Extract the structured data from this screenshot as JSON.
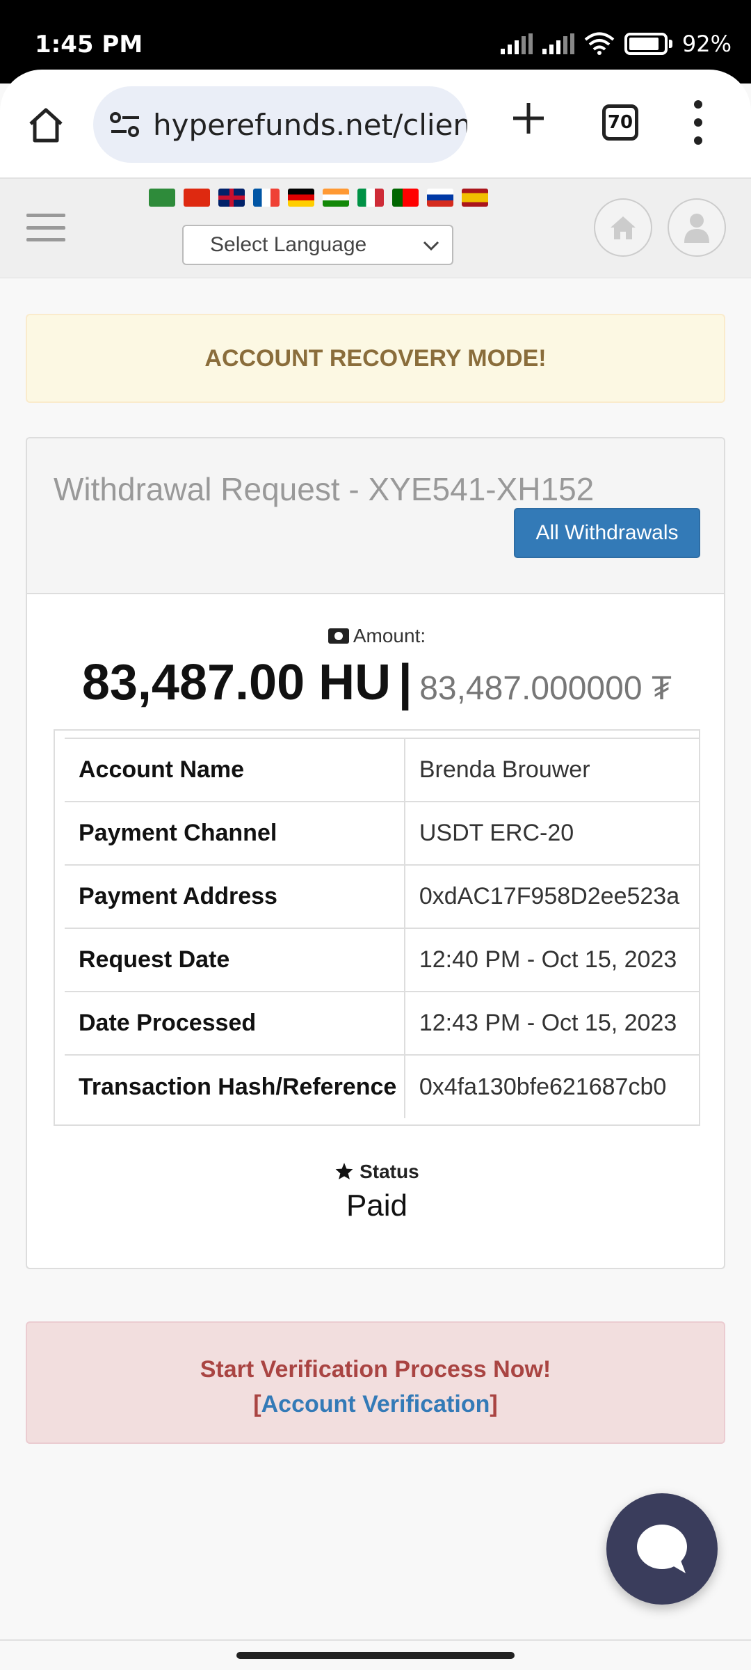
{
  "status_bar": {
    "time": "1:45 PM",
    "battery": "92%"
  },
  "browser": {
    "url": "hyperefunds.net/client",
    "tab_count": "70"
  },
  "header": {
    "language_placeholder": "Select Language",
    "flags": [
      "arabic",
      "chinese",
      "english",
      "french",
      "german",
      "hindi",
      "italian",
      "portuguese",
      "russian",
      "spanish"
    ]
  },
  "alert_warning": {
    "text": "ACCOUNT RECOVERY MODE!"
  },
  "panel": {
    "title": "Withdrawal Request - XYE541-XH152",
    "all_withdrawals_label": "All Withdrawals",
    "amount_label": "Amount:",
    "amount_main": "83,487.00 HU",
    "amount_separator": "|",
    "amount_secondary": "83,487.000000 ₮",
    "details": [
      {
        "key": "Account Name",
        "value": "Brenda Brouwer"
      },
      {
        "key": "Payment Channel",
        "value": "USDT ERC-20"
      },
      {
        "key": "Payment Address",
        "value": "0xdAC17F958D2ee523a"
      },
      {
        "key": "Request Date",
        "value": "12:40 PM - Oct 15, 2023"
      },
      {
        "key": "Date Processed",
        "value": "12:43 PM - Oct 15, 2023"
      },
      {
        "key": "Transaction Hash/Reference",
        "value": "0x4fa130bfe621687cb0"
      }
    ],
    "status_label": "Status",
    "status_value": "Paid"
  },
  "alert_danger": {
    "title": "Start Verification Process Now!",
    "bracket_open": "[",
    "link_text": "Account Verification",
    "bracket_close": "]"
  },
  "colors": {
    "primary": "#337ab7",
    "warning_text": "#8a6d3b",
    "danger_text": "#a94442",
    "chat_bubble": "#3a3d5c"
  }
}
